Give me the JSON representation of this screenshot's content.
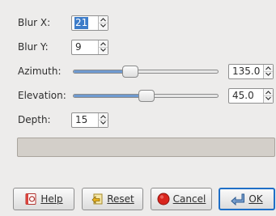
{
  "fields": {
    "blur_x": {
      "label": "Blur X:",
      "value": "21"
    },
    "blur_y": {
      "label": "Blur Y:",
      "value": "9"
    },
    "azimuth": {
      "label": "Azimuth:",
      "value": "135.0",
      "fraction": 0.375
    },
    "elevation": {
      "label": "Elevation:",
      "value": "45.0",
      "fraction": 0.5
    },
    "depth": {
      "label": "Depth:",
      "value": "15"
    }
  },
  "progress": {
    "fraction": 0
  },
  "buttons": {
    "help": "Help",
    "reset": "Reset",
    "cancel": "Cancel",
    "ok": "OK"
  },
  "colors": {
    "accent": "#3d7cc9",
    "slider_fill": "#6f9ad0",
    "background": "#edeceb"
  },
  "icons": {
    "help": "help-book-icon",
    "reset": "reset-icon",
    "cancel": "cancel-icon",
    "ok": "ok-icon"
  }
}
